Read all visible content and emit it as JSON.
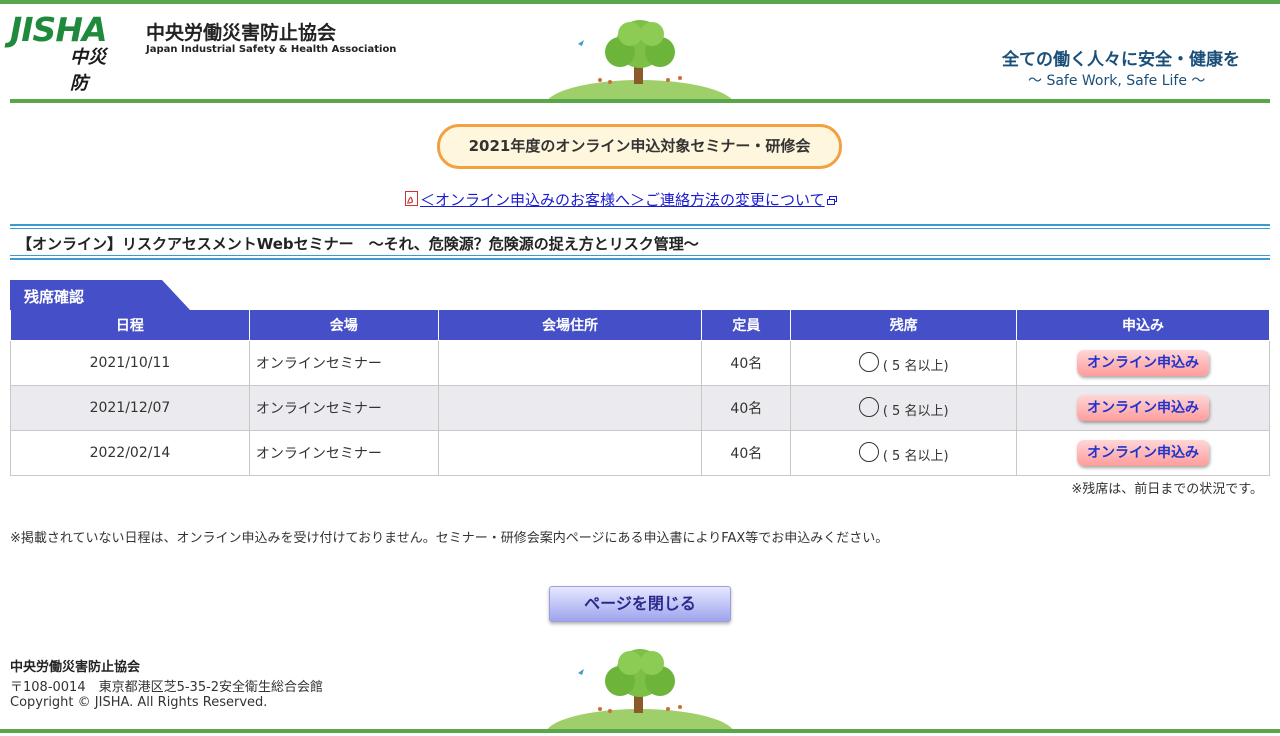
{
  "header": {
    "logo_main": "JISHA",
    "logo_sub": "中災防",
    "org_name_jp": "中央労働災害防止協会",
    "org_name_en": "Japan Industrial Safety & Health Association",
    "slogan_jp": "全ての働く人々に安全・健康を",
    "slogan_en": "～ Safe Work, Safe Life ～"
  },
  "page_title": "2021年度のオンライン申込対象セミナー・研修会",
  "notice_link": "＜オンライン申込みのお客様へ＞ご連絡方法の変更について",
  "seminar_title": "【オンライン】リスクアセスメントWebセミナー　～それ、危険源？危険源の捉え方とリスク管理～",
  "seat_section_label": "残席確認",
  "table": {
    "headers": [
      "日程",
      "会場",
      "会場住所",
      "定員",
      "残席",
      "申込み"
    ],
    "rows": [
      {
        "date": "2021/10/11",
        "venue": "オンラインセミナー",
        "address": "",
        "capacity": "40名",
        "seat_note": "( 5 名以上)",
        "apply_label": "オンライン申込み"
      },
      {
        "date": "2021/12/07",
        "venue": "オンラインセミナー",
        "address": "",
        "capacity": "40名",
        "seat_note": "( 5 名以上)",
        "apply_label": "オンライン申込み"
      },
      {
        "date": "2022/02/14",
        "venue": "オンラインセミナー",
        "address": "",
        "capacity": "40名",
        "seat_note": "( 5 名以上)",
        "apply_label": "オンライン申込み"
      }
    ]
  },
  "seat_status_note": "※残席は、前日までの状況です。",
  "footnote": "※掲載されていない日程は、オンライン申込みを受け付けておりません。セミナー・研修会案内ページにある申込書によりFAX等でお申込みください。",
  "close_button": "ページを閉じる",
  "footer": {
    "org": "中央労働災害防止協会",
    "address": "〒108-0014　東京都港区芝5-35-2安全衛生総合会館",
    "copyright": "Copyright © JISHA. All Rights Reserved."
  },
  "colors": {
    "brand_green": "#5aa64a",
    "table_header": "#4550c8",
    "badge_border": "#f2a040",
    "link_blue": "#1a1ad0"
  },
  "icons": [
    "pdf-icon",
    "external-window-icon",
    "tree-logo-icon",
    "circle-available-icon"
  ]
}
